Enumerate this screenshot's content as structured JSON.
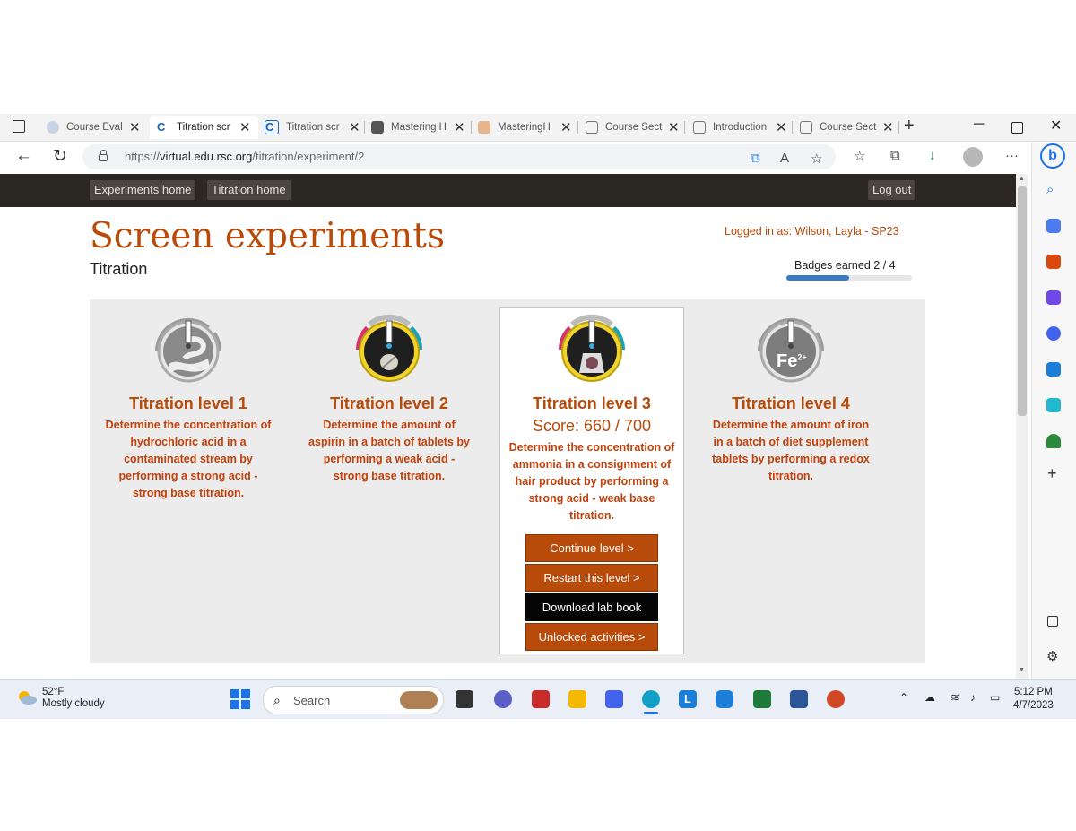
{
  "browser": {
    "tabs": [
      {
        "title": "Course Eval",
        "active": false
      },
      {
        "title": "Titration scr",
        "active": true
      },
      {
        "title": "Titration scr",
        "active": false
      },
      {
        "title": "Mastering H",
        "active": false
      },
      {
        "title": "MasteringH",
        "active": false
      },
      {
        "title": "Course Sect",
        "active": false
      },
      {
        "title": "Introduction",
        "active": false
      },
      {
        "title": "Course Sect",
        "active": false
      }
    ],
    "url_prefix": "https://",
    "url_domain": "virtual.edu.rsc.org",
    "url_path": "/titration/experiment/2"
  },
  "site_nav": {
    "experiments_home": "Experiments home",
    "titration_home": "Titration home",
    "log_out": "Log out"
  },
  "header": {
    "title": "Screen experiments",
    "subtitle": "Titration",
    "logged_in": "Logged in as: Wilson, Layla - SP23",
    "badges_earned": "Badges earned 2 / 4",
    "badges_fraction": 0.5
  },
  "levels": [
    {
      "title": "Titration level 1",
      "description": "Determine the concentration of hydrochloric acid in a contaminated stream by performing a strong acid - strong base titration."
    },
    {
      "title": "Titration level 2",
      "description": "Determine the amount of aspirin in a batch of tablets by performing a weak acid - strong base titration."
    },
    {
      "title": "Titration level 3",
      "score": "Score: 660 / 700",
      "description": "Determine the concentration of ammonia in a consignment of hair product by performing a strong acid - weak base titration.",
      "buttons": {
        "continue": "Continue level >",
        "restart": "Restart this level >",
        "download": "Download lab book",
        "unlocked": "Unlocked activities >"
      }
    },
    {
      "title": "Titration level 4",
      "description": "Determine the amount of iron in a batch of diet supplement tablets by performing a redox titration.",
      "icon_label": "Fe",
      "icon_sup": "2+"
    }
  ],
  "taskbar": {
    "temperature": "52°F",
    "weather": "Mostly cloudy",
    "search": "Search",
    "time": "5:12 PM",
    "date": "4/7/2023"
  },
  "colors": {
    "brand": "#b84a0a",
    "progress": "#3a79c6",
    "site_bar": "#2b2723"
  }
}
